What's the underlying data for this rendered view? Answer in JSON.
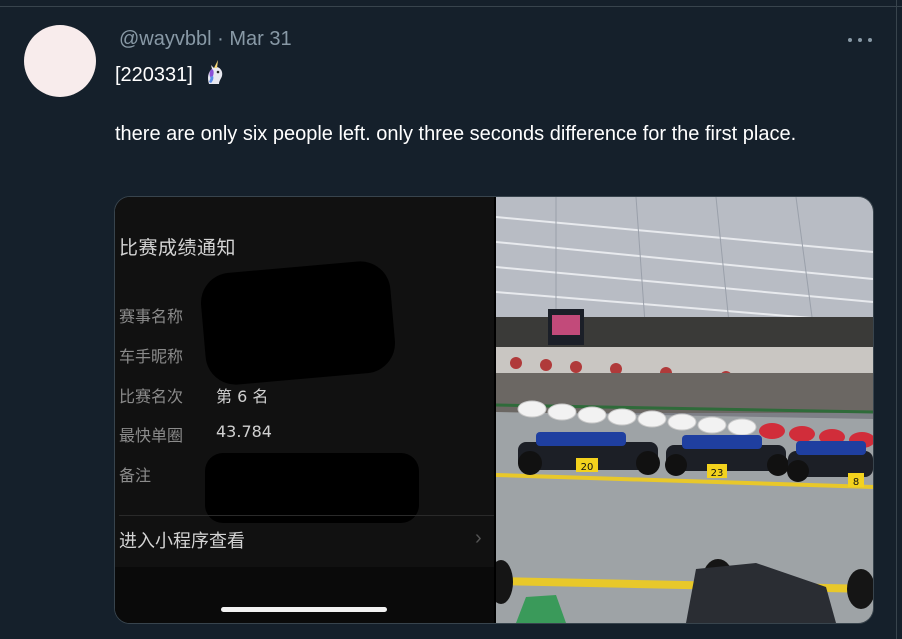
{
  "tweet": {
    "handle": "@wayvbbl",
    "separator": "·",
    "date": "Mar 31",
    "code": "[220331]",
    "emoji": "unicorn-emoji",
    "text": "there are only six people left. only three seconds difference for the first place.",
    "more_icon": "more-horizontal-icon"
  },
  "screenshot": {
    "title": "比赛成绩通知",
    "rows": [
      {
        "label": "赛事名称",
        "value": ""
      },
      {
        "label": "车手昵称",
        "value": ""
      },
      {
        "label": "比赛名次",
        "value": "第 6 名"
      },
      {
        "label": "最快单圈",
        "value": "43.784"
      },
      {
        "label": "备注",
        "value": ""
      }
    ],
    "enter_label": "进入小程序查看",
    "chevron": "›"
  },
  "photo": {
    "kart_numbers": [
      "20",
      "23",
      "8"
    ]
  },
  "colors": {
    "background": "#15202b",
    "muted": "#8899a6",
    "border": "#38444d"
  }
}
